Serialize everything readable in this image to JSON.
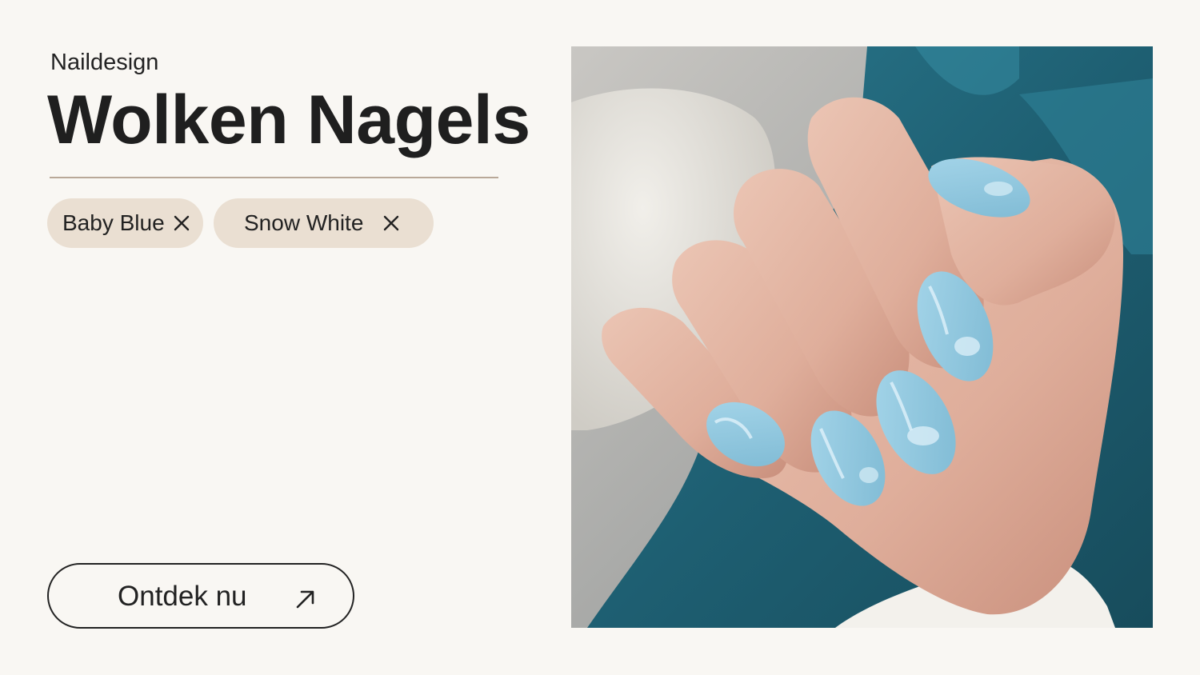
{
  "header": {
    "eyebrow": "Naildesign",
    "title": "Wolken Nagels"
  },
  "filters": [
    {
      "label": "Baby Blue",
      "icon": "close-icon"
    },
    {
      "label": "Snow White",
      "icon": "close-icon"
    }
  ],
  "cta": {
    "label": "Ontdek nu",
    "icon": "arrow-up-right-icon"
  },
  "image": {
    "subject": "hand-with-cloud-nails-photo"
  },
  "colors": {
    "background": "#f9f7f3",
    "chip": "#eadfd2",
    "divider": "#b9a898",
    "text": "#222222",
    "nail": "#8ec6df",
    "blanket": "#1f5f73"
  }
}
